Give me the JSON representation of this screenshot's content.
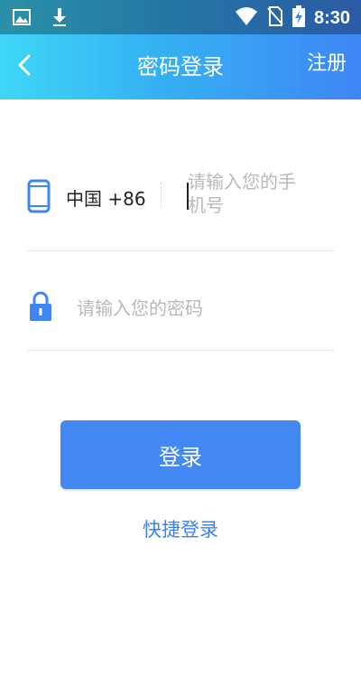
{
  "status_bar": {
    "time": "8:30",
    "icons": [
      "image-icon",
      "download-icon",
      "wifi-icon",
      "no-sim-icon",
      "battery-charging-icon"
    ]
  },
  "header": {
    "title": "密码登录",
    "back_icon": "chevron-left-icon",
    "register_label": "注册"
  },
  "phone": {
    "icon": "phone-icon",
    "country_code": "中国 +86",
    "placeholder": "请输入您的手机号"
  },
  "password": {
    "icon": "lock-icon",
    "placeholder": "请输入您的密码"
  },
  "login_label": "登录",
  "quick_login_label": "快捷登录",
  "colors": {
    "primary": "#4488f4",
    "link": "#3b82f0",
    "gradient_start": "#3fd6f6",
    "gradient_end": "#3f86f4"
  }
}
